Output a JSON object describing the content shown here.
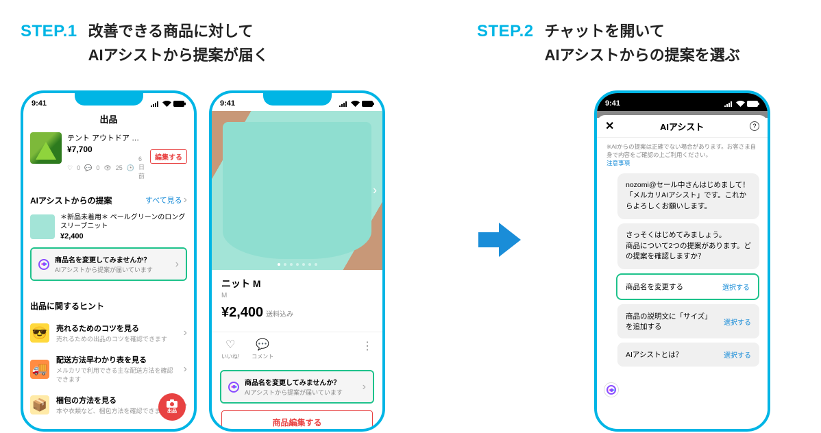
{
  "step1": {
    "label": "STEP.1",
    "text": "改善できる商品に対して\nAIアシストから提案が届く"
  },
  "step2": {
    "label": "STEP.2",
    "text": "チャットを開いて\nAIアシストからの提案を選ぶ"
  },
  "status": {
    "time": "9:41"
  },
  "phoneA": {
    "title": "出品",
    "product": {
      "name": "テント アウトドア キャ…",
      "price": "¥7,700",
      "likes": "0",
      "comments": "0",
      "views": "25",
      "age": "6日前",
      "edit": "編集する"
    },
    "section": {
      "title": "AIアシストからの提案",
      "action": "すべて見る"
    },
    "suggestion": {
      "name": "＊新品未着用＊ ペールグリーンのロングスリーブニット",
      "price": "¥2,400"
    },
    "banner": {
      "t1": "商品名を変更してみませんか？",
      "t2": "AIアシストから提案が届いています"
    },
    "hints_title": "出品に関するヒント",
    "hints": [
      {
        "t1": "売れるためのコツを見る",
        "t2": "売れるための出品のコツを確認できます",
        "ic": "😎"
      },
      {
        "t1": "配送方法早わかり表を見る",
        "t2": "メルカリで利用できる主な配送方法を確認できます",
        "ic": "🚚"
      },
      {
        "t1": "梱包の方法を見る",
        "t2": "本や衣類など、梱包方法を確認できます",
        "ic": "📦"
      }
    ],
    "fab": "出品"
  },
  "phoneB": {
    "name": "ニット M",
    "size": "M",
    "price": "¥2,400",
    "price_note": "送料込み",
    "actions": {
      "like": "いいね!",
      "comment": "コメント"
    },
    "banner": {
      "t1": "商品名を変更してみませんか？",
      "t2": "AIアシストから提案が届いています"
    },
    "edit": "商品編集する"
  },
  "phoneC": {
    "title": "AIアシスト",
    "disclaimer": "※AIからの提案は正確でない場合があります。お客さま自身で内容をご確認の上ご利用ください。",
    "notice": "注意事項",
    "bubble1": "nozomi@セール中さんはじめまして！「メルカリAIアシスト」です。これからよろしくお願いします。",
    "bubble2": "さっそくはじめてみましょう。\n商品について2つの提案があります。どの提案を確認しますか？",
    "options": [
      {
        "label": "商品名を変更する",
        "sel": "選択する",
        "hl": true
      },
      {
        "label": "商品の説明文に「サイズ」を追加する",
        "sel": "選択する",
        "hl": false
      },
      {
        "label": "AIアシストとは？",
        "sel": "選択する",
        "hl": false
      }
    ]
  }
}
